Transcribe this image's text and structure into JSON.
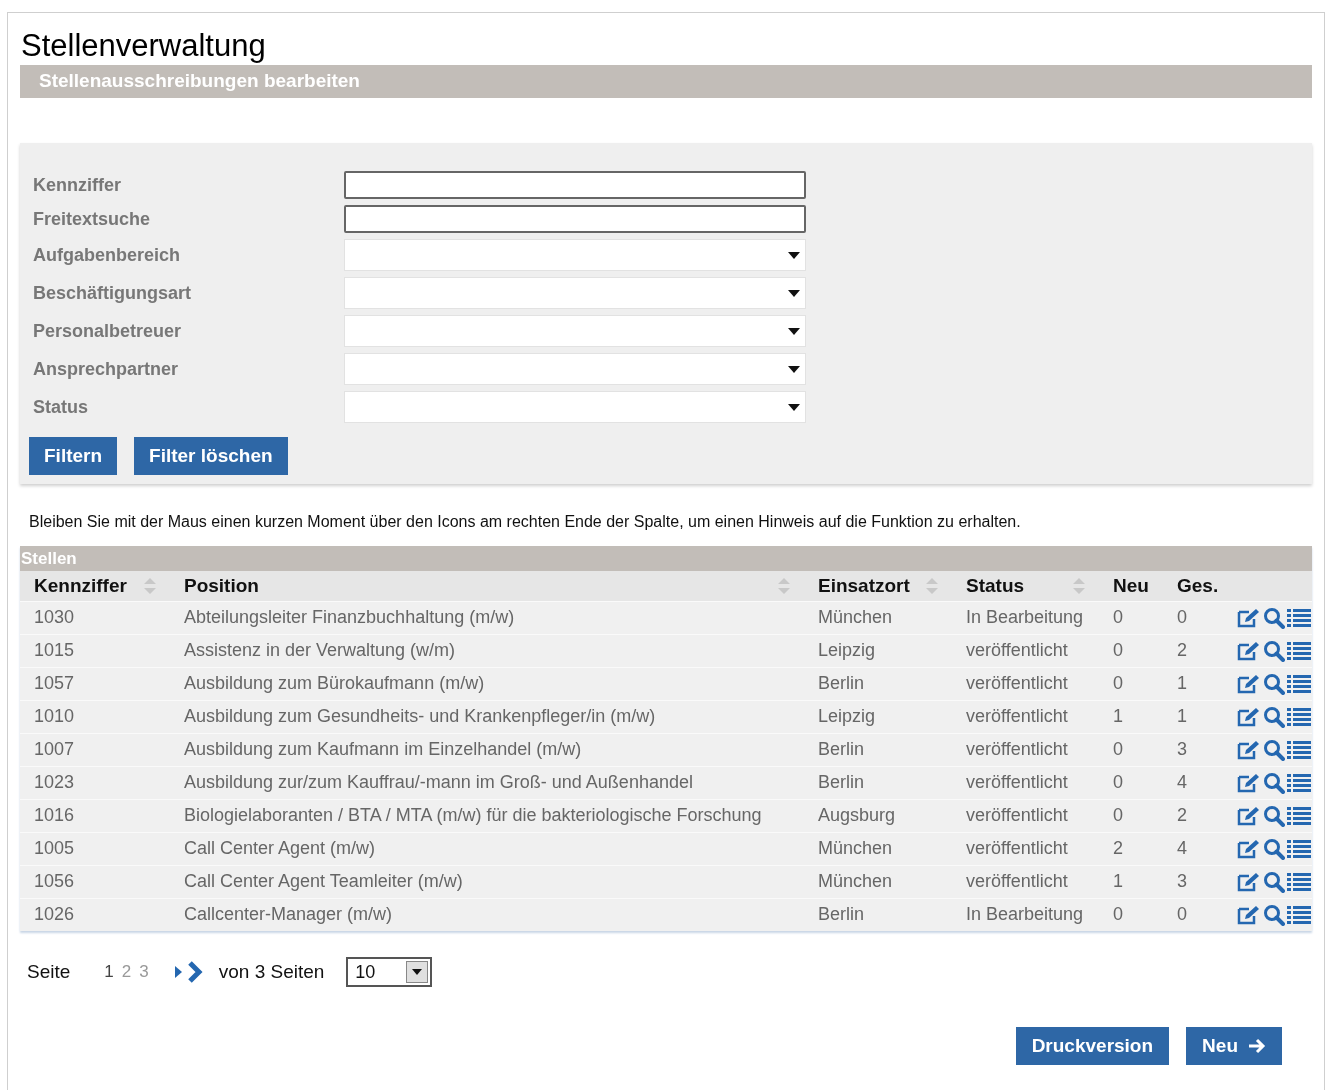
{
  "title": "Stellenverwaltung",
  "subtitle": "Stellenausschreibungen bearbeiten",
  "filters": [
    {
      "label": "Kennziffer",
      "kind": "text"
    },
    {
      "label": "Freitextsuche",
      "kind": "text"
    },
    {
      "label": "Aufgabenbereich",
      "kind": "select"
    },
    {
      "label": "Beschäftigungsart",
      "kind": "select"
    },
    {
      "label": "Personalbetreuer",
      "kind": "select"
    },
    {
      "label": "Ansprechpartner",
      "kind": "select"
    },
    {
      "label": "Status",
      "kind": "select"
    }
  ],
  "filter_buttons": [
    "Filtern",
    "Filter löschen"
  ],
  "hint": "Bleiben Sie mit der Maus einen kurzen Moment über den Icons am rechten Ende der Spalte, um einen Hinweis auf die Funktion zu erhalten.",
  "table": {
    "caption": "Stellen",
    "columns": [
      {
        "label": "Kennziffer",
        "sortable": true
      },
      {
        "label": "Position",
        "sortable": true
      },
      {
        "label": "Einsatzort",
        "sortable": true
      },
      {
        "label": "Status",
        "sortable": true
      },
      {
        "label": "Neu",
        "sortable": false
      },
      {
        "label": "Ges.",
        "sortable": false
      }
    ],
    "rows": [
      [
        "1030",
        "Abteilungsleiter Finanzbuchhaltung (m/w)",
        "München",
        "In Bearbeitung",
        "0",
        "0"
      ],
      [
        "1015",
        "Assistenz in der Verwaltung (w/m)",
        "Leipzig",
        "veröffentlicht",
        "0",
        "2"
      ],
      [
        "1057",
        "Ausbildung zum Bürokaufmann (m/w)",
        "Berlin",
        "veröffentlicht",
        "0",
        "1"
      ],
      [
        "1010",
        "Ausbildung zum Gesundheits- und Krankenpfleger/in (m/w)",
        "Leipzig",
        "veröffentlicht",
        "1",
        "1"
      ],
      [
        "1007",
        "Ausbildung zum Kaufmann im Einzelhandel (m/w)",
        "Berlin",
        "veröffentlicht",
        "0",
        "3"
      ],
      [
        "1023",
        "Ausbildung zur/zum Kauffrau/-mann im Groß- und Außenhandel",
        "Berlin",
        "veröffentlicht",
        "0",
        "4"
      ],
      [
        "1016",
        "Biologielaboranten / BTA / MTA (m/w) für die bakteriologische Forschung",
        "Augsburg",
        "veröffentlicht",
        "0",
        "2"
      ],
      [
        "1005",
        "Call Center Agent (m/w)",
        "München",
        "veröffentlicht",
        "2",
        "4"
      ],
      [
        "1056",
        "Call Center Agent Teamleiter (m/w)",
        "München",
        "veröffentlicht",
        "1",
        "3"
      ],
      [
        "1026",
        "Callcenter-Manager (m/w)",
        "Berlin",
        "In Bearbeitung",
        "0",
        "0"
      ]
    ]
  },
  "pagination": {
    "label": "Seite",
    "pages": [
      {
        "label": "1",
        "selected": true
      },
      {
        "label": "2",
        "selected": false
      },
      {
        "label": "3",
        "selected": false
      }
    ],
    "total": "von 3 Seiten",
    "page_size": "10"
  },
  "actions": [
    {
      "label": "Druckversion",
      "arrow": false
    },
    {
      "label": "Neu",
      "arrow": true
    }
  ]
}
